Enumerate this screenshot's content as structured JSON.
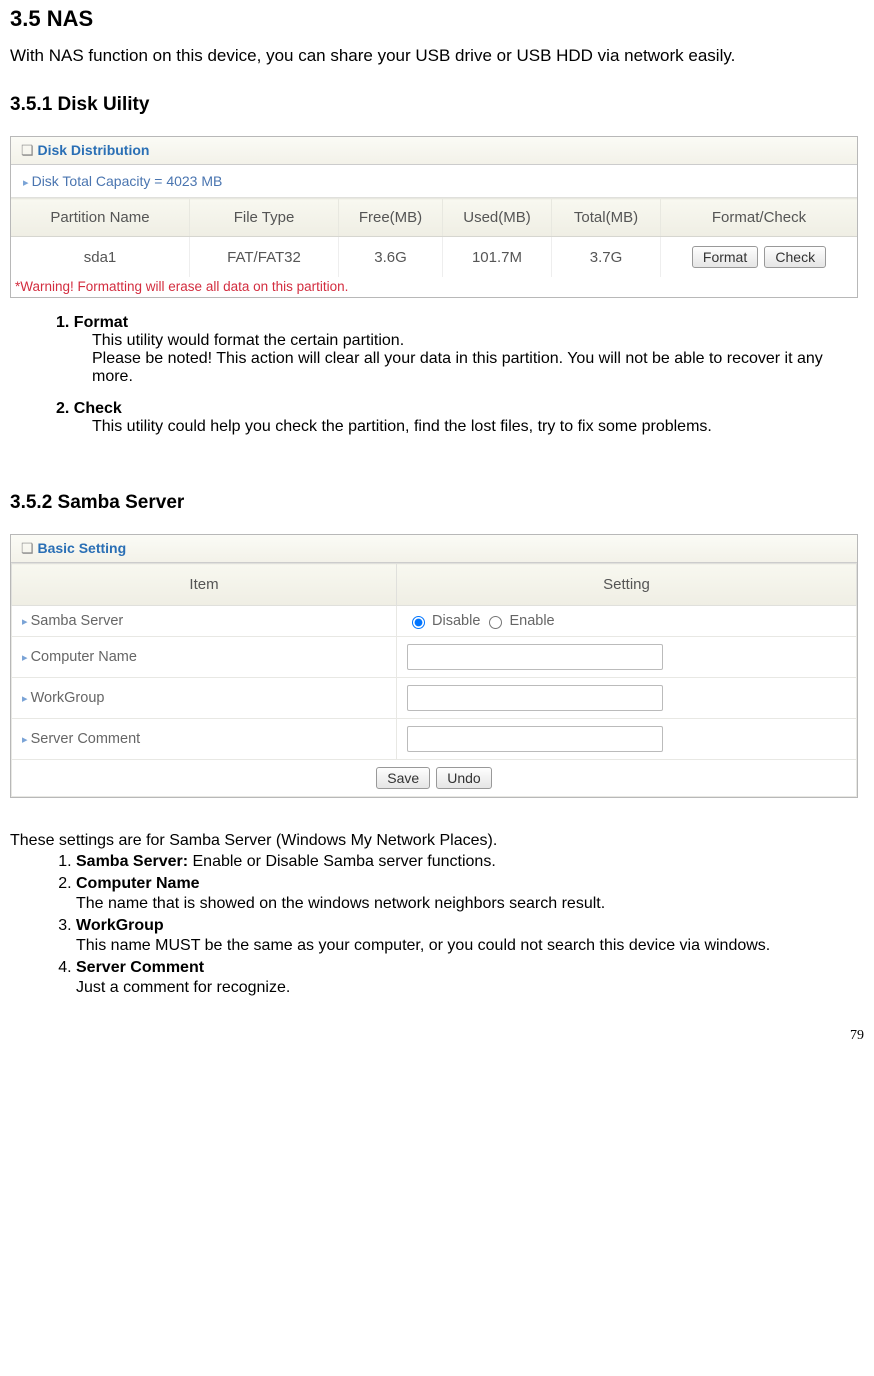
{
  "section_title": "3.5 NAS",
  "intro": "With NAS function on this device, you can share your USB drive or USB HDD via network easily.",
  "sub1_title": "3.5.1 Disk Uility",
  "disk_panel": {
    "title": "Disk Distribution",
    "capacity_line": "Disk Total Capacity = 4023 MB",
    "headers": {
      "partition": "Partition Name",
      "filetype": "File Type",
      "free": "Free(MB)",
      "used": "Used(MB)",
      "total": "Total(MB)",
      "action": "Format/Check"
    },
    "row": {
      "partition": "sda1",
      "filetype": "FAT/FAT32",
      "free": "3.6G",
      "used": "101.7M",
      "total": "3.7G"
    },
    "buttons": {
      "format": "Format",
      "check": "Check"
    },
    "warning": "*Warning! Formatting will erase all data on this partition."
  },
  "disk_doc": {
    "h1": "1. Format",
    "l1a": "This utility would format the certain partition.",
    "l1b": "Please be noted! This action will clear all your data in this partition. You will not be able to recover it any more.",
    "h2": "2. Check",
    "l2a": "This utility could help you check the partition, find the lost files, try to fix some problems."
  },
  "sub2_title": "3.5.2 Samba Server",
  "samba_panel": {
    "title": "Basic Setting",
    "col_item": "Item",
    "col_setting": "Setting",
    "rows": {
      "server": "Samba Server",
      "name": "Computer Name",
      "group": "WorkGroup",
      "comment": "Server Comment"
    },
    "radio": {
      "disable": "Disable",
      "enable": "Enable"
    },
    "buttons": {
      "save": "Save",
      "undo": "Undo"
    }
  },
  "samba_doc": {
    "intro": "These settings are for Samba Server (Windows My Network Places).",
    "i1_label": "Samba Server:",
    "i1_text": " Enable or Disable Samba server functions.",
    "i2_label": "Computer Name",
    "i2_text": "The name that is showed on the windows network neighbors search result.",
    "i3_label": "WorkGroup",
    "i3_text": "This name MUST be the same as your computer, or you could not search this device via windows.",
    "i4_label": "Server Comment",
    "i4_text": "Just a comment for recognize."
  },
  "page_number": "79"
}
